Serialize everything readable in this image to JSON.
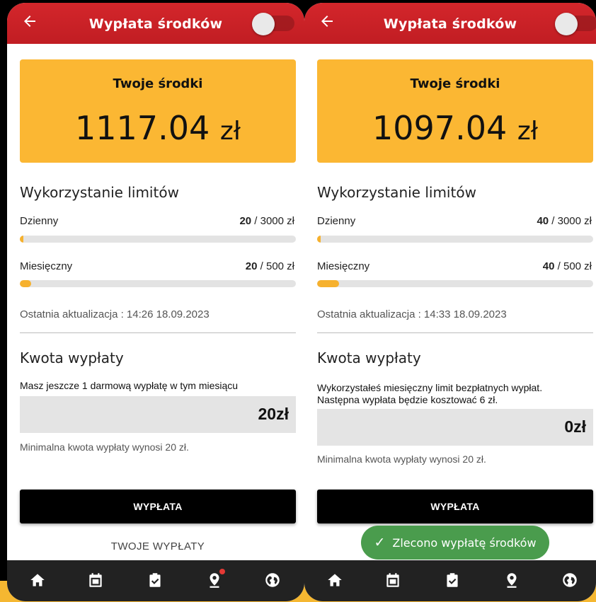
{
  "colors": {
    "appbar": "#c81f25",
    "accent": "#fbb733",
    "toast": "#4a9c4d",
    "nav": "#222222"
  },
  "screens": [
    {
      "appbar": {
        "title": "Wypłata środków",
        "back_icon": "arrow-left-icon",
        "toggle_on": false
      },
      "balance": {
        "label": "Twoje środki",
        "amount": "1117.04",
        "currency": "zł"
      },
      "limits": {
        "title": "Wykorzystanie limitów",
        "daily": {
          "label": "Dzienny",
          "used": "20",
          "limit": " / 3000 zł",
          "used_fraction": 0.0067
        },
        "monthly": {
          "label": "Miesięczny",
          "used": "20",
          "limit": " / 500 zł",
          "used_fraction": 0.04
        }
      },
      "updated": "Ostatnia aktualizacja : 14:26 18.09.2023",
      "payout": {
        "title": "Kwota wypłaty",
        "info": "Masz jeszcze 1 darmową wypłatę w tym miesiącu",
        "amount": "20zł",
        "min_note": "Minimalna kwota wypłaty wynosi 20 zł."
      },
      "buttons": {
        "payout": "WYPŁATA",
        "my_payouts": "TWOJE WYPŁATY"
      },
      "nav": [
        "home-icon",
        "calendar-icon",
        "clipboard-check-icon",
        "map-pin-icon",
        "globe-icon"
      ]
    },
    {
      "appbar": {
        "title": "Wypłata środków",
        "back_icon": "arrow-left-icon",
        "toggle_on": false
      },
      "balance": {
        "label": "Twoje środki",
        "amount": "1097.04",
        "currency": "zł"
      },
      "limits": {
        "title": "Wykorzystanie limitów",
        "daily": {
          "label": "Dzienny",
          "used": "40",
          "limit": " / 3000 zł",
          "used_fraction": 0.0133
        },
        "monthly": {
          "label": "Miesięczny",
          "used": "40",
          "limit": " / 500 zł",
          "used_fraction": 0.08
        }
      },
      "updated": "Ostatnia aktualizacja : 14:33 18.09.2023",
      "payout": {
        "title": "Kwota wypłaty",
        "info": "Wykorzystałeś miesięczny limit bezpłatnych wypłat. Następna wypłata będzie kosztować 6 zł.",
        "amount": "0zł",
        "min_note": "Minimalna kwota wypłaty wynosi 20 zł."
      },
      "buttons": {
        "payout": "WYPŁATA"
      },
      "toast": "Zlecono wypłatę środków",
      "nav": [
        "home-icon",
        "calendar-icon",
        "clipboard-check-icon",
        "map-pin-icon",
        "globe-icon"
      ]
    }
  ]
}
